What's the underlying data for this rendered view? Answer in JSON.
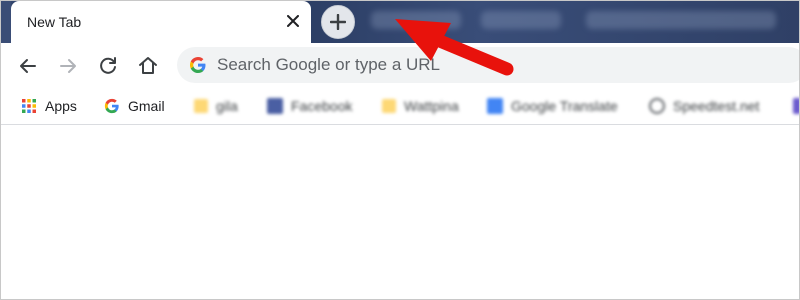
{
  "tab": {
    "title": "New Tab",
    "close_glyph": "×"
  },
  "tabstrip": {
    "newtab_icon": "plus-icon",
    "background_tabs_blurred": true
  },
  "toolbar": {
    "back_icon": "back-arrow-icon",
    "forward_icon": "forward-arrow-icon",
    "reload_icon": "reload-icon",
    "home_icon": "home-icon",
    "omnibox_placeholder": "Search Google or type a URL"
  },
  "bookmarks": {
    "items": [
      {
        "label": "Apps",
        "icon": "apps-grid-icon",
        "blurred": false
      },
      {
        "label": "Gmail",
        "icon": "google-g-icon",
        "blurred": false
      },
      {
        "label": "gila",
        "icon": "folder-icon",
        "blurred": true
      },
      {
        "label": "Facebook",
        "icon": "facebook-icon",
        "blurred": true
      },
      {
        "label": "Wattpina",
        "icon": "folder-icon",
        "blurred": true
      },
      {
        "label": "Google Translate",
        "icon": "translate-icon",
        "blurred": true
      },
      {
        "label": "Speedtest.net",
        "icon": "speedtest-icon",
        "blurred": true
      }
    ]
  },
  "annotation": {
    "arrow_color": "#e8120c",
    "points_to": "new-tab-button"
  },
  "colors": {
    "tabstrip": "#2f4066",
    "omnibox": "#f1f3f4",
    "folder": "#fdd875"
  }
}
